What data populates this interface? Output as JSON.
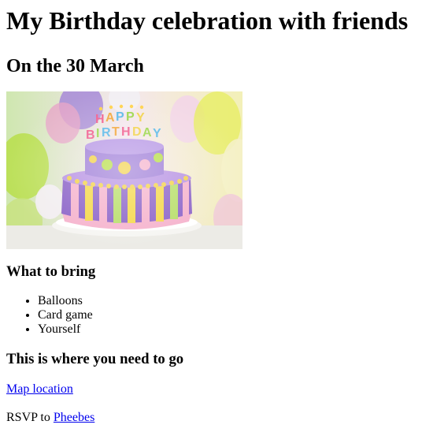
{
  "title": "My Birthday celebration with friends",
  "date_heading": "On the 30 March",
  "photo": {
    "icon": "birthday-cake-photo",
    "candle_letters": "HAPPY BIRTHDAY"
  },
  "bring": {
    "heading": "What to bring",
    "items": [
      "Balloons",
      "Card game",
      "Yourself"
    ]
  },
  "location": {
    "heading": "This is where you need to go",
    "map_link": "Map location"
  },
  "rsvp": {
    "prefix": "RSVP to",
    "name": "Pheebes"
  },
  "colors": {
    "link": "#0000ee",
    "text": "#000000",
    "background": "#ffffff"
  }
}
